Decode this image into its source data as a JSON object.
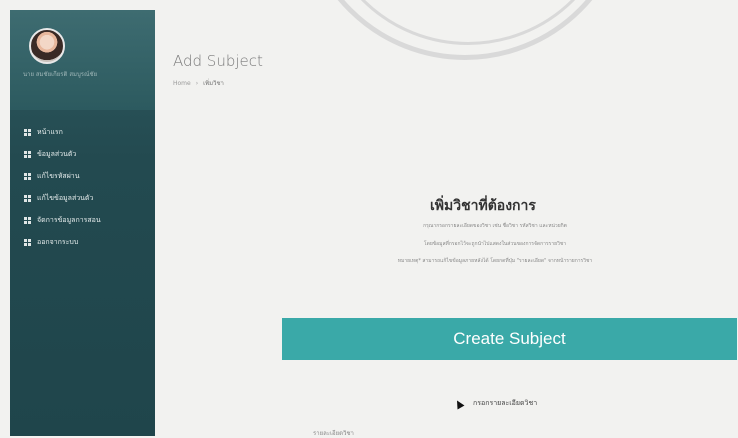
{
  "profile": {
    "name": "นาย สมชัยเกียรติ สมบูรณ์ชัย"
  },
  "sidebar": {
    "items": [
      {
        "label": "หน้าแรก"
      },
      {
        "label": "ข้อมูลส่วนตัว"
      },
      {
        "label": "แก้ไขรหัสผ่าน"
      },
      {
        "label": "แก้ไขข้อมูลส่วนตัว"
      },
      {
        "label": "จัดการข้อมูลการสอน"
      },
      {
        "label": "ออกจากระบบ"
      }
    ]
  },
  "page": {
    "title": "Add Subject",
    "breadcrumb": {
      "home": "Home",
      "current": "เพิ่มวิชา"
    }
  },
  "panel": {
    "heading": "เพิ่มวิชาที่ต้องการ",
    "desc1": "กรุณากรอกรายละเอียดของวิชา เช่น ชื่อวิชา รหัสวิชา และหน่วยกิต",
    "desc2": "โดยข้อมูลที่กรอกไว้จะถูกนำไปแสดงในส่วนของการจัดการรายวิชา",
    "desc3": "หมายเหตุ* สามารถแก้ไขข้อมูลภายหลังได้ โดยกดที่ปุ่ม \"รายละเอียด\" จากหน้ารายการวิชา",
    "create_button": "Create Subject",
    "sub_link": "กรอกรายละเอียดวิชา",
    "footer": "รายละเอียดวิชา"
  }
}
